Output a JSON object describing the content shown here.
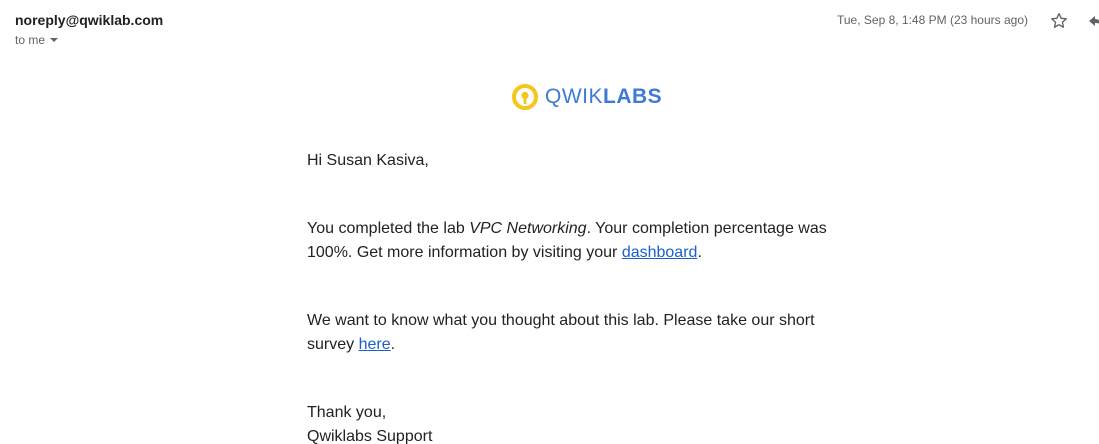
{
  "header": {
    "sender": "noreply@qwiklab.com",
    "recipient_label": "to me",
    "date": "Tue, Sep 8, 1:48 PM (23 hours ago)",
    "star_icon": "star-outline-icon",
    "reply_icon": "reply-icon"
  },
  "logo": {
    "brand_light": "QWIK",
    "brand_bold": "LABS",
    "colors": {
      "ring": "#f6c61b",
      "text": "#3f7ad6"
    }
  },
  "email": {
    "greeting": "Hi Susan Kasiva,",
    "completion": {
      "prefix": "You completed the lab ",
      "lab_name": "VPC Networking",
      "middle": ". Your completion percentage was 100%. Get more information by visiting your ",
      "link_text": "dashboard",
      "suffix": "."
    },
    "survey": {
      "prefix": "We want to know what you thought about this lab. Please take our short survey ",
      "link_text": "here",
      "suffix": "."
    },
    "closing": "Thank you,",
    "signature": "Qwiklabs Support"
  },
  "colors": {
    "link": "#1a5fd0",
    "secondary_text": "#5f6368"
  }
}
